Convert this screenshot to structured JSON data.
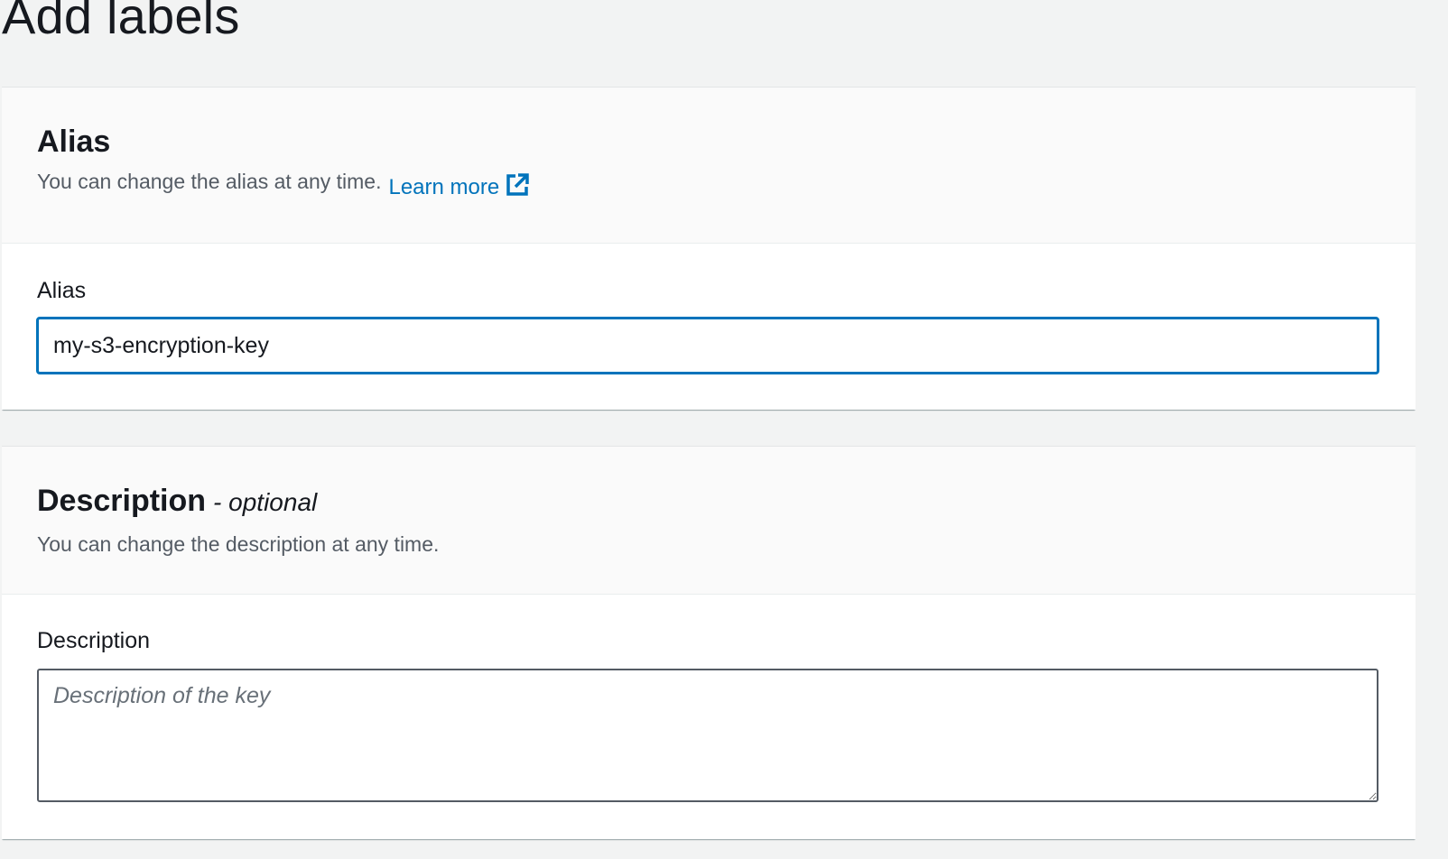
{
  "page": {
    "title": "Add labels"
  },
  "alias_section": {
    "title": "Alias",
    "description": "You can change the alias at any time.",
    "learn_more_label": "Learn more",
    "learn_more_icon": "external-link-icon",
    "field_label": "Alias",
    "field_value": "my-s3-encryption-key"
  },
  "description_section": {
    "title": "Description",
    "optional_tag": "- optional",
    "description": "You can change the description at any time.",
    "field_label": "Description",
    "field_value": "",
    "field_placeholder": "Description of the key"
  },
  "colors": {
    "link": "#0073bb",
    "focus_border": "#0073bb",
    "background": "#f2f3f3",
    "text": "#16191f",
    "secondary_text": "#545b64"
  }
}
